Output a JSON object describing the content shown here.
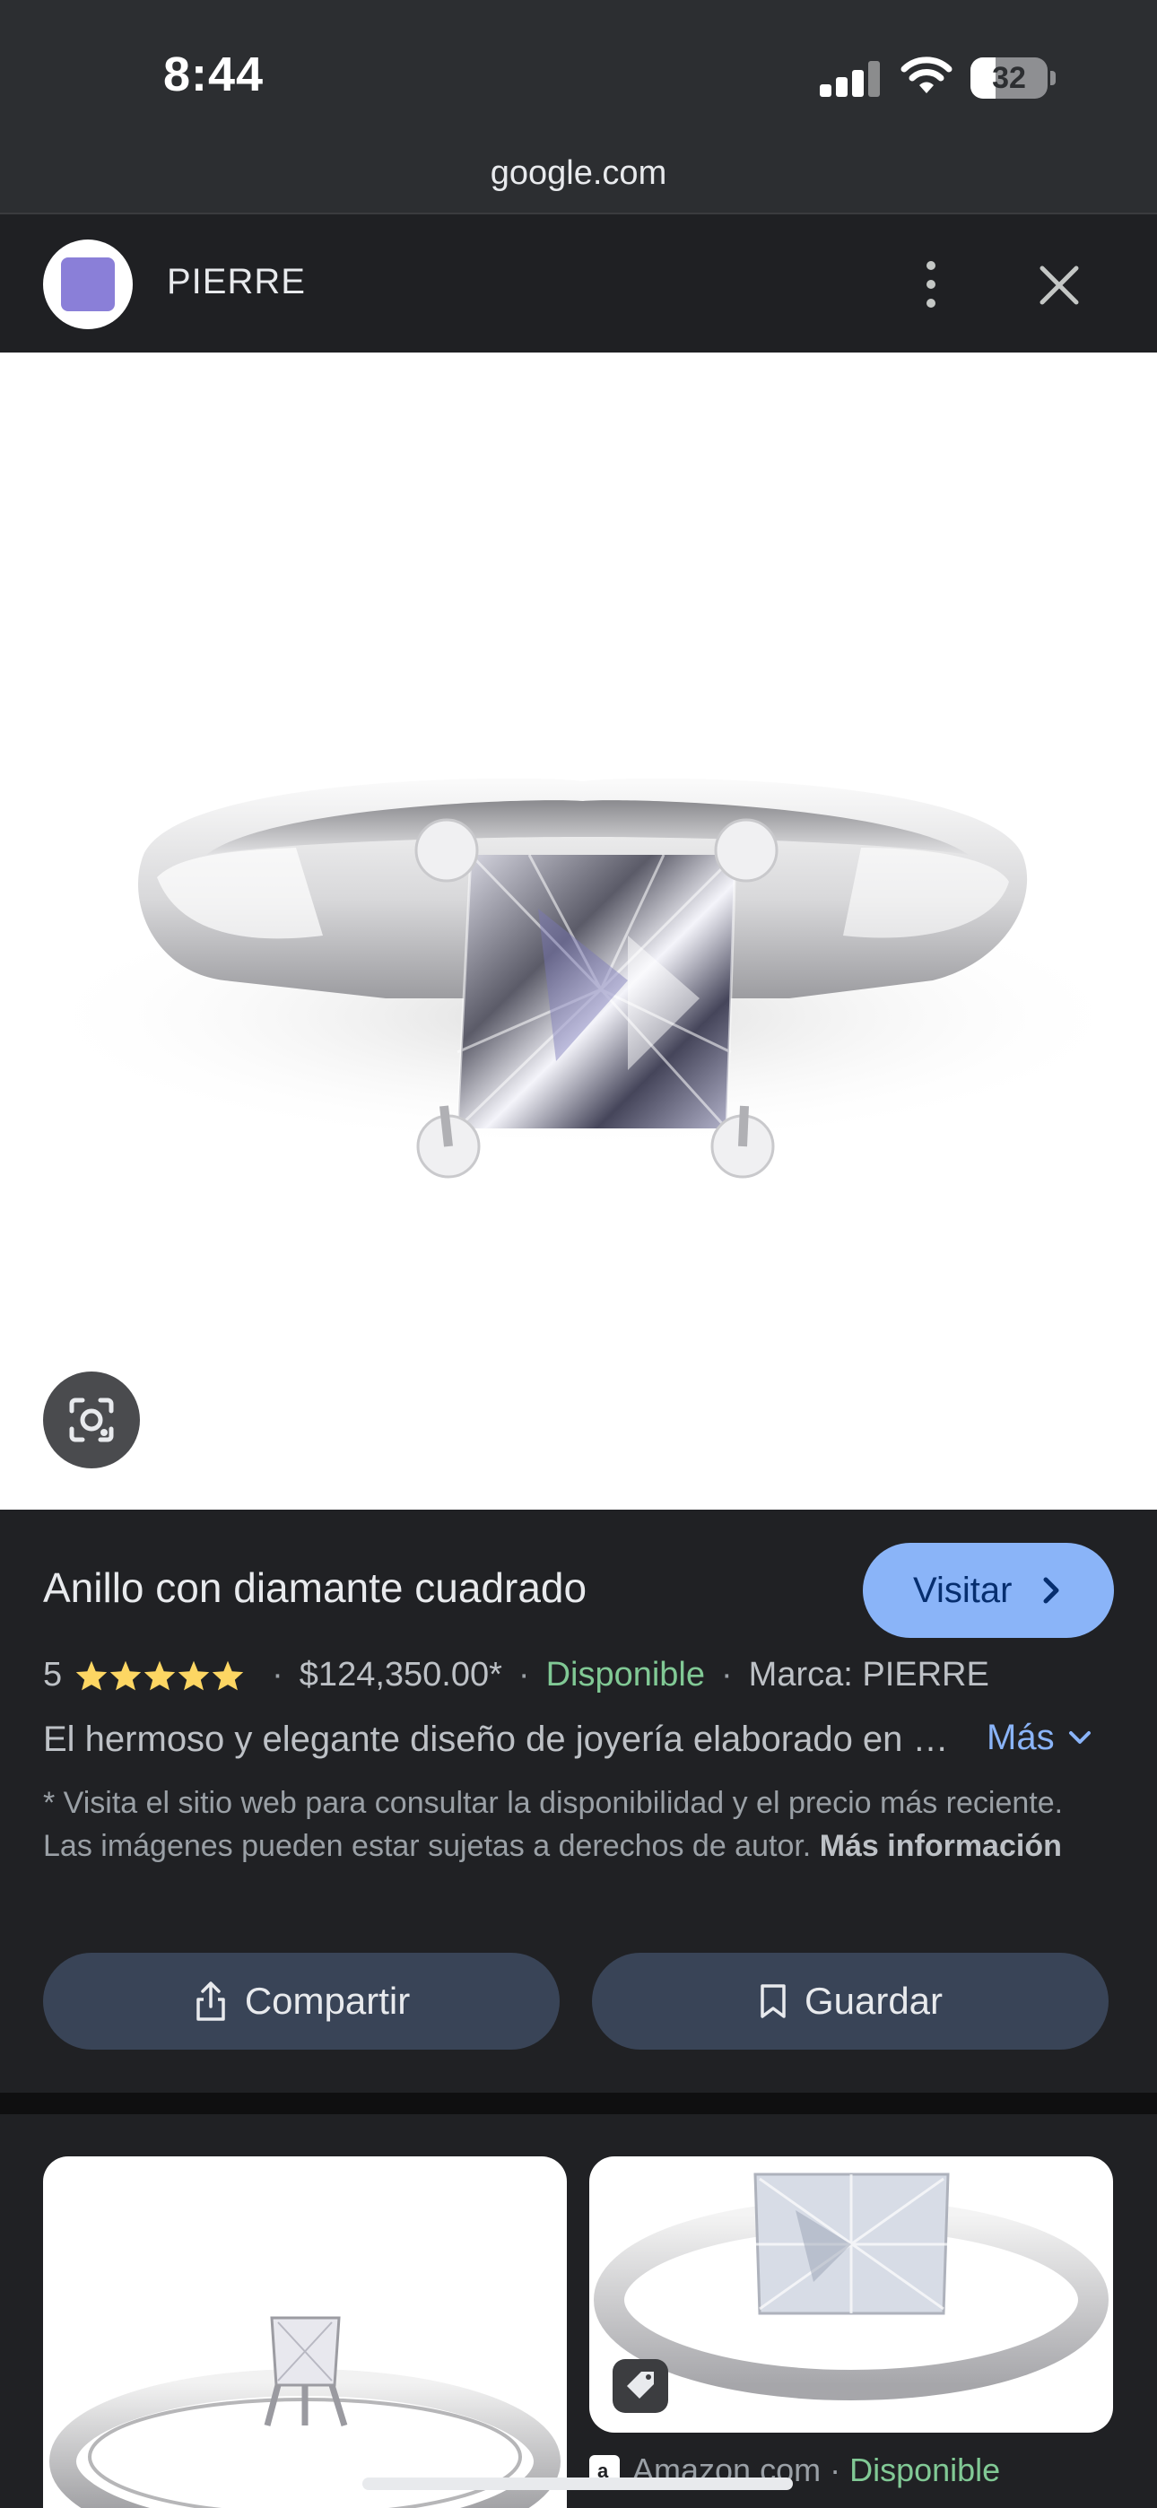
{
  "status": {
    "time": "8:44",
    "battery": "32",
    "battery_level": 0.32
  },
  "browser": {
    "url": "google.com"
  },
  "site": {
    "name": "PIERRE"
  },
  "product": {
    "title": "Anillo con diamante cuadrado",
    "visit_label": "Visitar",
    "rating": "5",
    "rating_value": 5,
    "price": "$124,350.00*",
    "availability": "Disponible",
    "brand": "Marca: PIERRE",
    "description": "El hermoso y elegante diseño de joyería elaborado en oro blanco con diamante cuadrado",
    "more_label": "Más",
    "disclaimer": "* Visita el sitio web para consultar la disponibilidad y el precio más reciente. Las imágenes pueden estar sujetas a derechos de autor.",
    "disclaimer_link": "Más información",
    "share_label": "Compartir",
    "save_label": "Guardar"
  },
  "results": [
    {
      "source": "",
      "availability": ""
    },
    {
      "source": "Amazon.com",
      "availability": "Disponible"
    }
  ],
  "colors": {
    "accent": "#8ab4f8",
    "available": "#81c995",
    "star": "#fdd663",
    "background": "#202124"
  }
}
